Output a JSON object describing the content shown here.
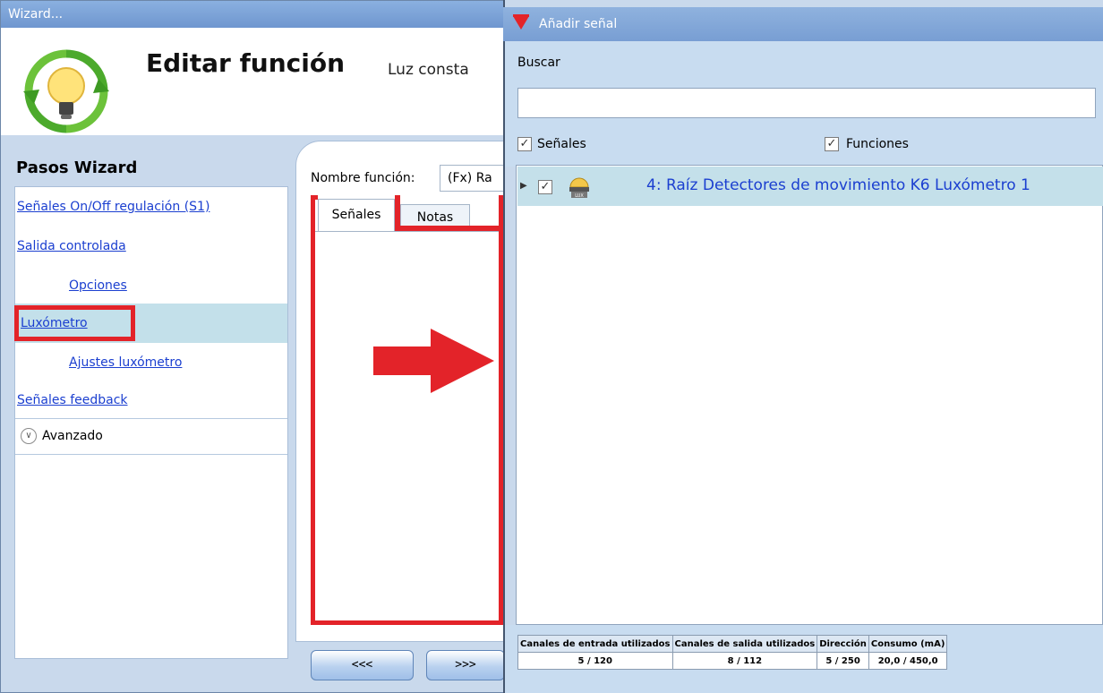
{
  "wizard": {
    "window_title": "Wizard...",
    "title": "Editar función",
    "subtitle": "Luz consta",
    "steps_heading": "Pasos Wizard",
    "steps": [
      {
        "label": "Señales On/Off regulación (S1)"
      },
      {
        "label": "Salida controlada"
      },
      {
        "label": "Opciones"
      },
      {
        "label": "Luxómetro"
      },
      {
        "label": "Ajustes luxómetro"
      },
      {
        "label": "Señales feedback"
      }
    ],
    "advanced_label": "Avanzado",
    "function_name_label": "Nombre función:",
    "function_name_value": "(Fx) Ra",
    "tabs": [
      {
        "label": "Señales"
      },
      {
        "label": "Notas"
      }
    ],
    "prev_button": "<<<",
    "next_button": ">>>"
  },
  "dialog": {
    "title": "Añadir señal",
    "search_label": "Buscar",
    "search_value": "",
    "filter_signals": {
      "label": "Señales",
      "checked": true
    },
    "filter_functions": {
      "label": "Funciones",
      "checked": true
    },
    "rows": [
      {
        "label": "4: Raíz Detectores de movimiento K6 Luxómetro 1",
        "checked": true,
        "icon": "lux-sensor-icon"
      }
    ],
    "stats": {
      "headers": [
        "Canales de entrada utilizados",
        "Canales de salida utilizados",
        "Dirección",
        "Consumo (mA)"
      ],
      "values": [
        "5 / 120",
        "8 / 112",
        "5 / 250",
        "20,0 / 450,0"
      ]
    }
  },
  "colors": {
    "link": "#1b3fd0",
    "highlight": "#e32329",
    "selected_row": "#c3e0ea"
  }
}
